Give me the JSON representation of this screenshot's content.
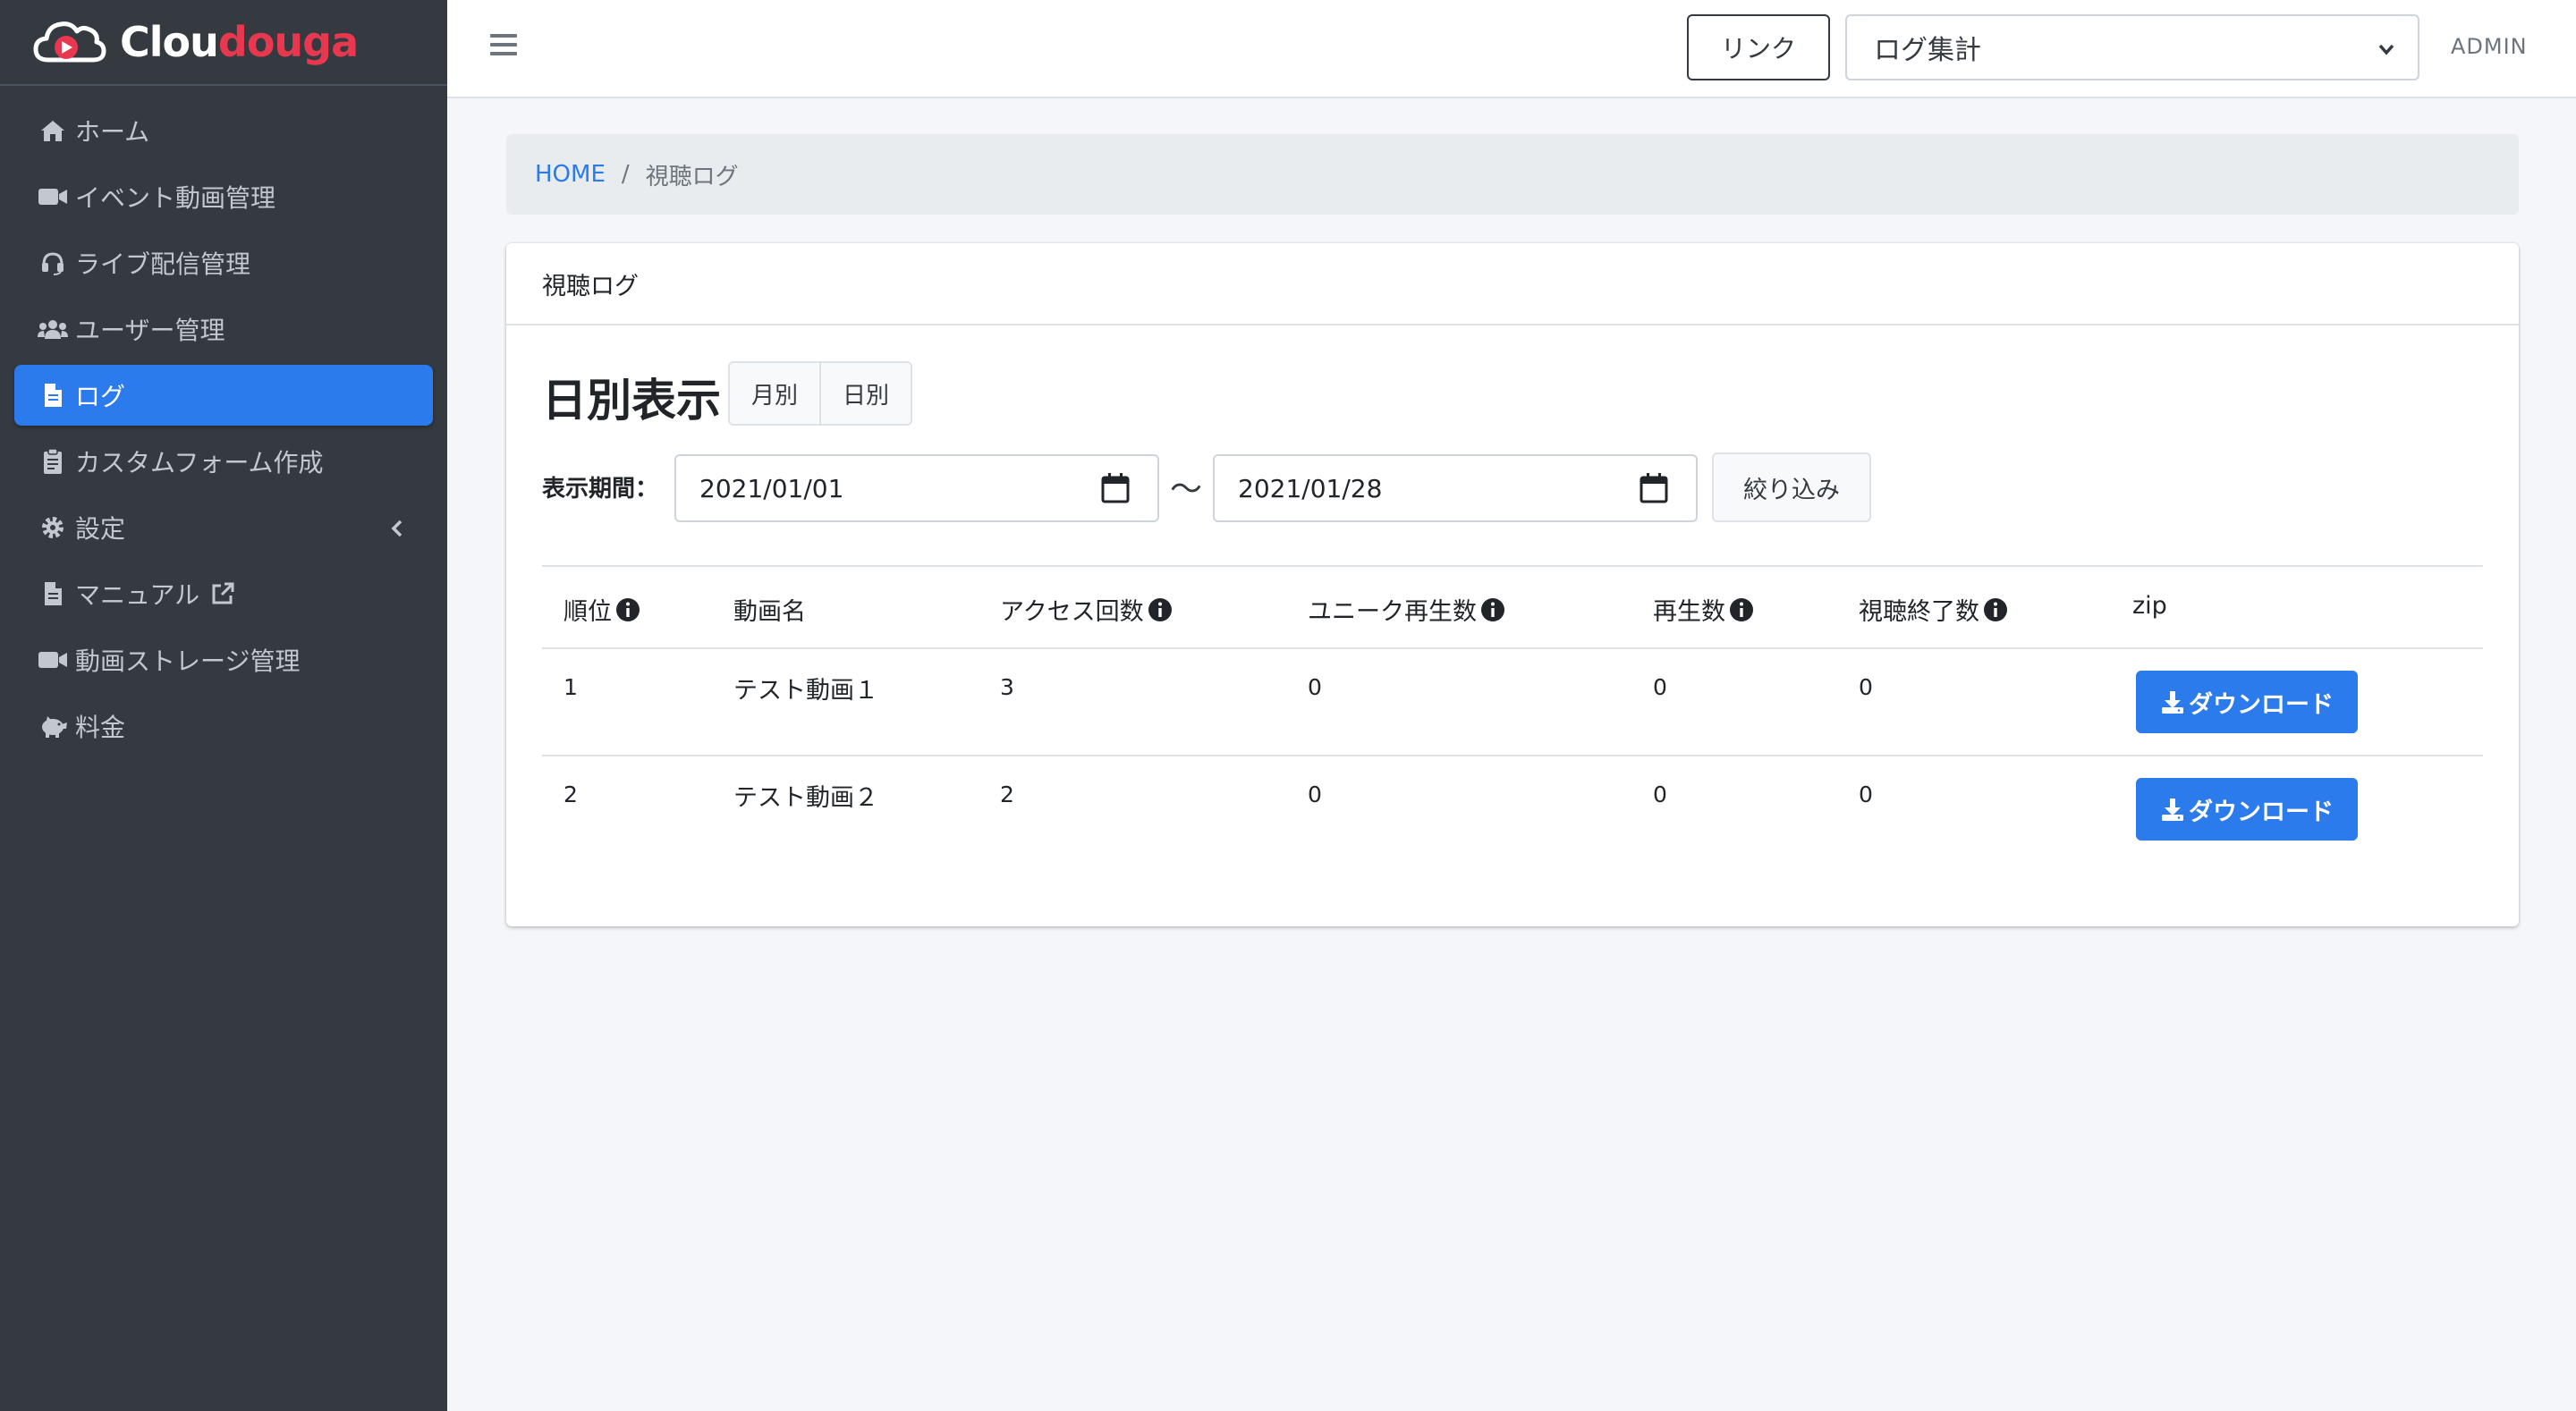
{
  "brand": {
    "name_part1": "Clou",
    "name_part2": "douga",
    "accent_color": "#e8384f"
  },
  "sidebar": {
    "items": [
      {
        "label": "ホーム",
        "icon": "home-icon"
      },
      {
        "label": "イベント動画管理",
        "icon": "video-camera-icon"
      },
      {
        "label": "ライブ配信管理",
        "icon": "headset-icon"
      },
      {
        "label": "ユーザー管理",
        "icon": "users-icon"
      },
      {
        "label": "ログ",
        "icon": "file-icon",
        "active": true
      },
      {
        "label": "カスタムフォーム作成",
        "icon": "clipboard-icon"
      },
      {
        "label": "設定",
        "icon": "gear-icon"
      },
      {
        "label": "マニュアル",
        "icon": "file-icon"
      },
      {
        "label": "動画ストレージ管理",
        "icon": "video-camera-icon"
      },
      {
        "label": "料金",
        "icon": "piggy-bank-icon"
      }
    ]
  },
  "topbar": {
    "link_label": "リンク",
    "select_value": "ログ集計",
    "user": "ADMIN"
  },
  "breadcrumb": {
    "home": "HOME",
    "separator": "/",
    "current": "視聴ログ"
  },
  "card": {
    "header": "視聴ログ",
    "view_title": "日別表示",
    "toggle": {
      "monthly": "月別",
      "daily": "日別"
    },
    "period_label": "表示期間：",
    "start_date": "2021/01/01",
    "end_date": "2021/01/28",
    "tilde": "〜",
    "filter_label": "絞り込み"
  },
  "table": {
    "columns": [
      "順位",
      "動画名",
      "アクセス回数",
      "ユニーク再生数",
      "再生数",
      "視聴終了数",
      "zip"
    ],
    "rows": [
      {
        "rank": "1",
        "name": "テスト動画１",
        "access": "3",
        "unique": "0",
        "plays": "0",
        "finished": "0",
        "download": "ダウンロード"
      },
      {
        "rank": "2",
        "name": "テスト動画２",
        "access": "2",
        "unique": "0",
        "plays": "0",
        "finished": "0",
        "download": "ダウンロード"
      }
    ]
  },
  "colors": {
    "primary": "#2b7bec",
    "sidebar_bg": "#343a40"
  }
}
